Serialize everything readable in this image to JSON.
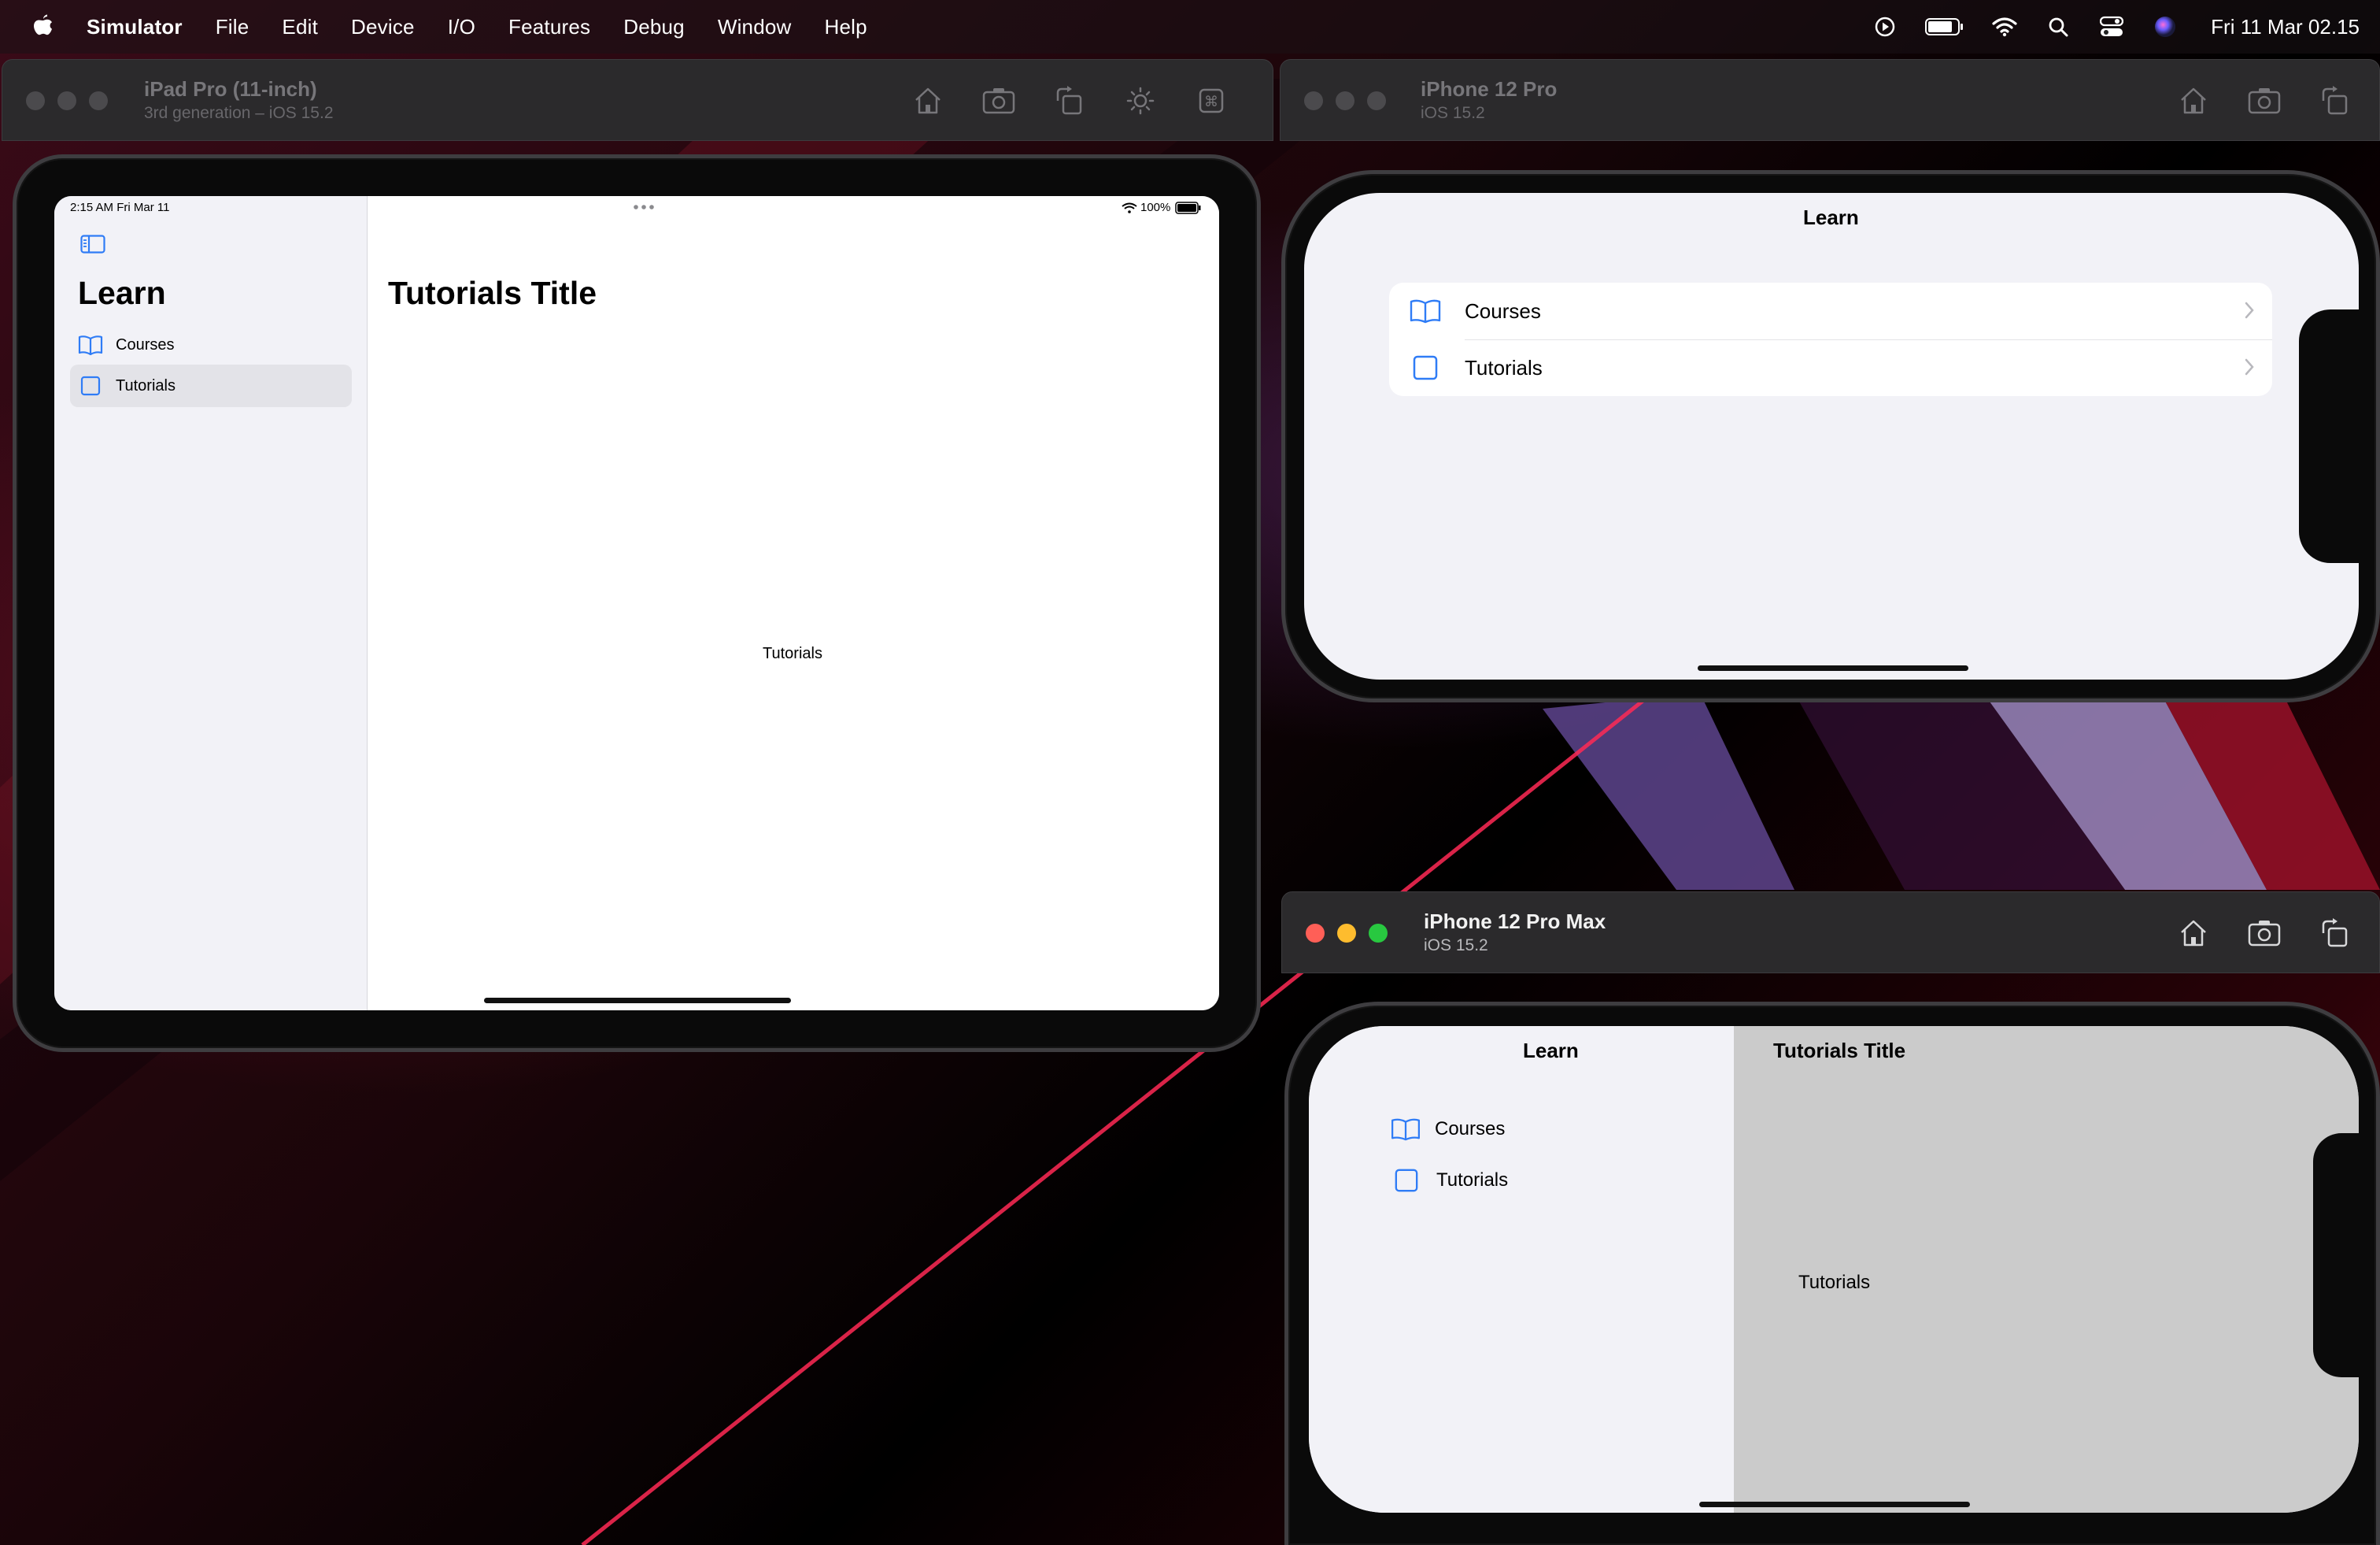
{
  "menubar": {
    "app": "Simulator",
    "items": [
      "File",
      "Edit",
      "Device",
      "I/O",
      "Features",
      "Debug",
      "Window",
      "Help"
    ],
    "clock": "Fri 11 Mar  02.15",
    "icons": [
      "play-circle-icon",
      "battery-icon",
      "wifi-icon",
      "search-icon",
      "control-center-icon",
      "siri-icon"
    ]
  },
  "ipad_window": {
    "title": "iPad Pro (11-inch)",
    "subtitle": "3rd generation – iOS 15.2",
    "status_time": "2:15 AM   Fri Mar 11",
    "status_battery": "100%",
    "sidebar_title": "Learn",
    "items": [
      {
        "label": "Courses",
        "icon": "book-icon",
        "selected": false
      },
      {
        "label": "Tutorials",
        "icon": "square-icon",
        "selected": true
      }
    ],
    "detail_title": "Tutorials Title",
    "detail_body": "Tutorials"
  },
  "iphone_pro_window": {
    "title": "iPhone 12 Pro",
    "subtitle": "iOS 15.2",
    "nav_title": "Learn",
    "items": [
      {
        "label": "Courses",
        "icon": "book-icon"
      },
      {
        "label": "Tutorials",
        "icon": "square-icon"
      }
    ]
  },
  "iphone_pro_max_window": {
    "title": "iPhone 12 Pro Max",
    "subtitle": "iOS 15.2",
    "sidebar_title": "Learn",
    "items": [
      {
        "label": "Courses",
        "icon": "book-icon"
      },
      {
        "label": "Tutorials",
        "icon": "square-icon"
      }
    ],
    "detail_title": "Tutorials Title",
    "detail_body": "Tutorials"
  },
  "colors": {
    "accent": "#2f7cf6",
    "traffic_red": "#ff5f57",
    "traffic_yellow": "#febc2e",
    "traffic_green": "#28c840"
  }
}
